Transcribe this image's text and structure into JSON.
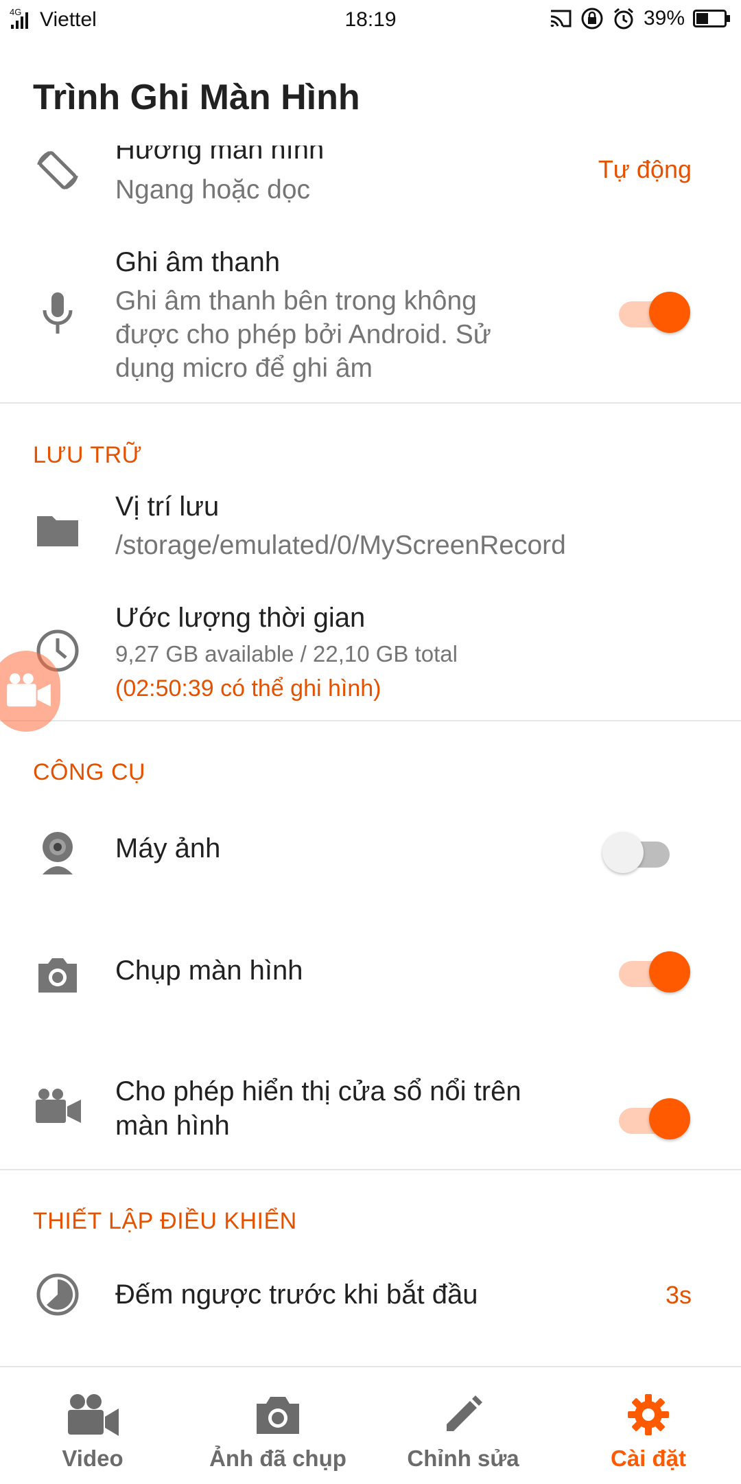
{
  "status_bar": {
    "signal": "4G",
    "carrier": "Viettel",
    "time": "18:19",
    "battery": "39%"
  },
  "app": {
    "title": "Trình Ghi Màn Hình"
  },
  "settings": {
    "orientation": {
      "title": "Hướng màn hình",
      "subtitle": "Ngang hoặc dọc",
      "value": "Tự động"
    },
    "audio": {
      "title": "Ghi âm thanh",
      "subtitle_lines": [
        "Ghi âm thanh bên trong không",
        "được cho phép bởi Android. Sử",
        "dụng micro để ghi âm"
      ],
      "enabled": true
    },
    "storage_section": "LƯU TRỮ",
    "save_location": {
      "title": "Vị trí lưu",
      "path": "/storage/emulated/0/MyScreenRecord"
    },
    "time_estimate": {
      "title": "Ước lượng thời gian",
      "space": "9,27 GB available / 22,10 GB total",
      "record_time": "(02:50:39 có thể ghi hình)"
    },
    "tools_section": "CÔNG CỤ",
    "camera": {
      "title": "Máy ảnh",
      "enabled": false
    },
    "screenshot": {
      "title": "Chụp màn hình",
      "enabled": true
    },
    "overlay": {
      "title_lines": [
        "Cho phép hiển thị cửa sổ nổi trên",
        "màn hình"
      ],
      "enabled": true
    },
    "control_section": "THIẾT LẬP ĐIỀU KHIỂN",
    "countdown": {
      "title": "Đếm ngược trước khi bắt đầu",
      "value": "3s"
    }
  },
  "bottom_nav": {
    "items": [
      {
        "label": "Video",
        "icon": "video-camera-icon",
        "active": false
      },
      {
        "label": "Ảnh đã chụp",
        "icon": "camera-icon",
        "active": false
      },
      {
        "label": "Chỉnh sửa",
        "icon": "pencil-icon",
        "active": false
      },
      {
        "label": "Cài đặt",
        "icon": "gear-icon",
        "active": true
      }
    ]
  },
  "colors": {
    "accent": "#ff5a00",
    "icon_gray": "#757575",
    "text": "#212121"
  }
}
